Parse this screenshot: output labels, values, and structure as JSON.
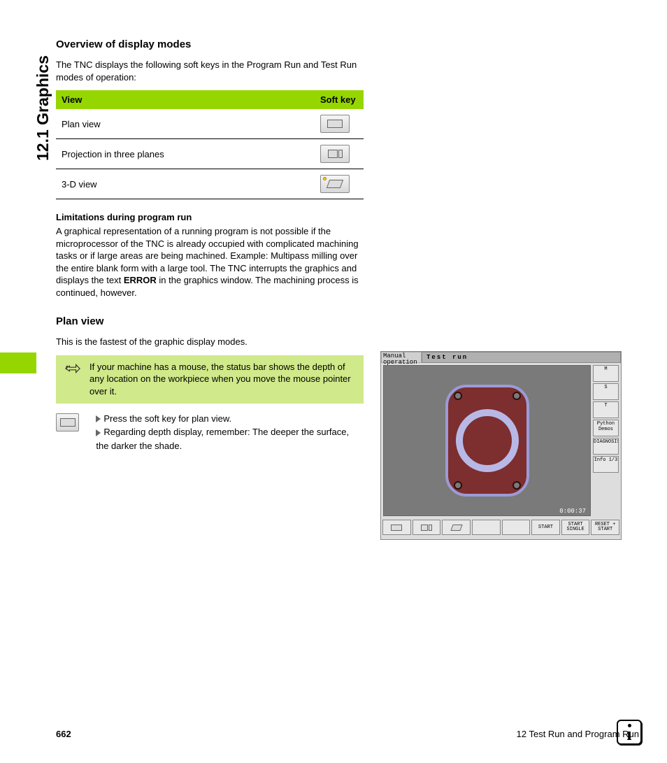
{
  "sideHeading": "12.1 Graphics",
  "section1": {
    "heading": "Overview of display modes",
    "intro": "The TNC displays the following soft keys in the Program Run and Test Run modes of operation:"
  },
  "table": {
    "colView": "View",
    "colSoft": "Soft key",
    "rows": [
      {
        "label": "Plan view"
      },
      {
        "label": "Projection in three planes"
      },
      {
        "label": "3-D view"
      }
    ]
  },
  "limitations": {
    "heading": "Limitations during program run",
    "text1": "A graphical representation of a running program is not possible if the microprocessor of the TNC is already occupied with complicated machining tasks or if large areas are being machined. Example: Multipass milling over the entire blank form with a large tool. The TNC interrupts the graphics and displays the text ",
    "err": "ERROR",
    "text2": " in the graphics window. The machining process is continued, however."
  },
  "section2": {
    "heading": "Plan view",
    "intro": "This is the fastest of the graphic display modes.",
    "tip": "If your machine has a mouse, the status bar shows the depth of any location on the workpiece when you move the mouse pointer over it.",
    "step1": "Press the soft key for plan view.",
    "step2": "Regarding depth display, remember: The deeper the surface, the darker the shade."
  },
  "screenshot": {
    "mode": "Manual operation",
    "title": "Test run",
    "side": {
      "m": "M",
      "s": "S",
      "t": "T",
      "python": "Python",
      "demos": "Demos",
      "diag": "DIAGNOSIS",
      "info": "Info 1/3"
    },
    "time": "0:00:37",
    "bottom": {
      "start": "START",
      "startSingle": "START SINGLE",
      "reset": "RESET + START"
    }
  },
  "footer": {
    "page": "662",
    "chapter": "12 Test Run and Program Run"
  }
}
